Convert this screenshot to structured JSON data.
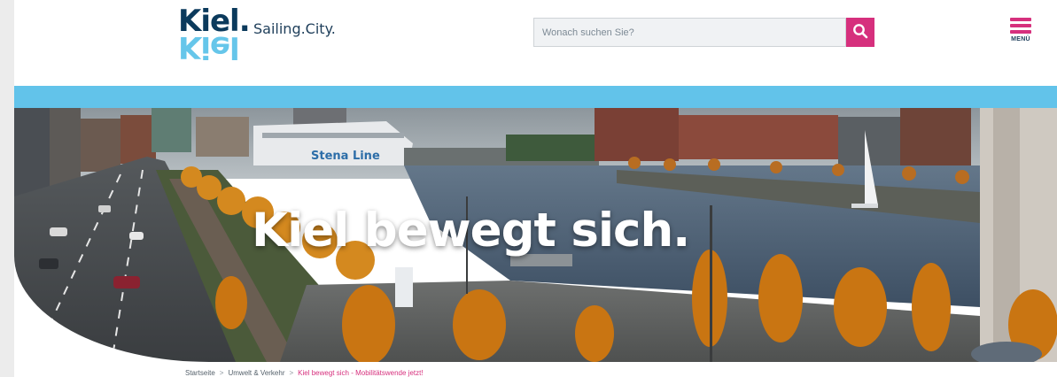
{
  "header": {
    "logo_word": "Kiel.",
    "logo_mirror": "Kiel",
    "logo_tagline": "Sailing.City.",
    "search_placeholder": "Wonach suchen Sie?",
    "search_icon": "magnifier-icon",
    "menu_label": "MENÜ",
    "menu_icon": "hamburger-icon"
  },
  "hero": {
    "headline": "Kiel bewegt sich.",
    "ship_text": "Stena Line"
  },
  "breadcrumb": {
    "items": [
      "Startseite",
      "Umwelt & Verkehr"
    ],
    "current": "Kiel bewegt sich - Mobilitätswende jetzt!",
    "separator": ">"
  },
  "colors": {
    "brand_navy": "#0b3a5c",
    "brand_light_blue": "#62c3ea",
    "accent_magenta": "#d6307d"
  }
}
